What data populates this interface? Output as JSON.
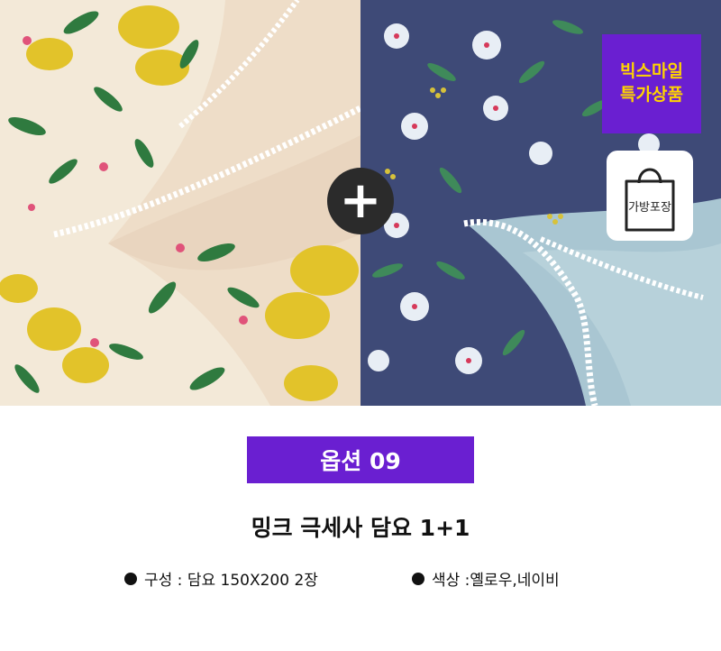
{
  "badge": {
    "line1": "빅스마일",
    "line2": "특가상품"
  },
  "bag": {
    "label": "가방포장"
  },
  "plus": {
    "symbol": "+"
  },
  "option": {
    "label": "옵션 09"
  },
  "product": {
    "title": "밍크 극세사 담요 1+1"
  },
  "specs": [
    {
      "text": "구성 : 담요 150X200 2장"
    },
    {
      "text": "색상 :옐로우,네이비"
    }
  ],
  "colors": {
    "accent": "#6a1fd1",
    "badge_text": "#ffd400",
    "navy": "#3d4a75",
    "cream": "#f2e7d5"
  }
}
